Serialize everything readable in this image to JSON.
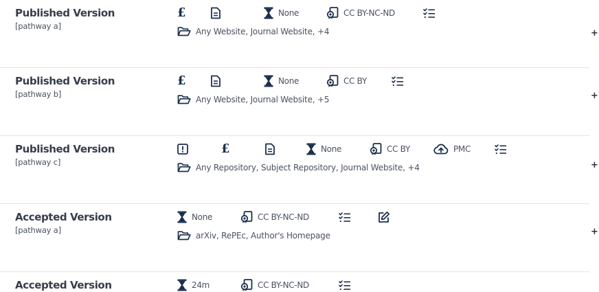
{
  "rows": [
    {
      "title": "Published Version",
      "pathway": "[pathway a]",
      "embargo": "None",
      "license": "CC BY-NC-ND",
      "locations": "Any Website, Journal Website, +4",
      "expand": "+"
    },
    {
      "title": "Published Version",
      "pathway": "[pathway b]",
      "embargo": "None",
      "license": "CC BY",
      "locations": "Any Website, Journal Website, +5",
      "expand": "+"
    },
    {
      "title": "Published Version",
      "pathway": "[pathway c]",
      "embargo": "None",
      "license": "CC BY",
      "repository": "PMC",
      "locations": "Any Repository, Subject Repository, Journal Website, +4",
      "expand": "+"
    },
    {
      "title": "Accepted Version",
      "pathway": "[pathway a]",
      "embargo": "None",
      "license": "CC BY-NC-ND",
      "locations": "arXiv, RePEc, Author's Homepage",
      "expand": "+"
    },
    {
      "title": "Accepted Version",
      "embargo": "24m",
      "license": "CC BY-NC-ND"
    }
  ],
  "icons": {
    "fee": "pound-icon",
    "copyright": "document-icon",
    "embargo": "hourglass-icon",
    "license": "license-icon",
    "conditions": "checklist-icon",
    "prerequisite": "alert-icon",
    "deposit": "cloud-upload-icon",
    "edit": "edit-icon",
    "location": "folder-open-icon"
  },
  "colors": {
    "icon": "#1b2f4c",
    "text": "#4a5160",
    "title": "#363d4a",
    "divider": "#e2e4e8"
  }
}
